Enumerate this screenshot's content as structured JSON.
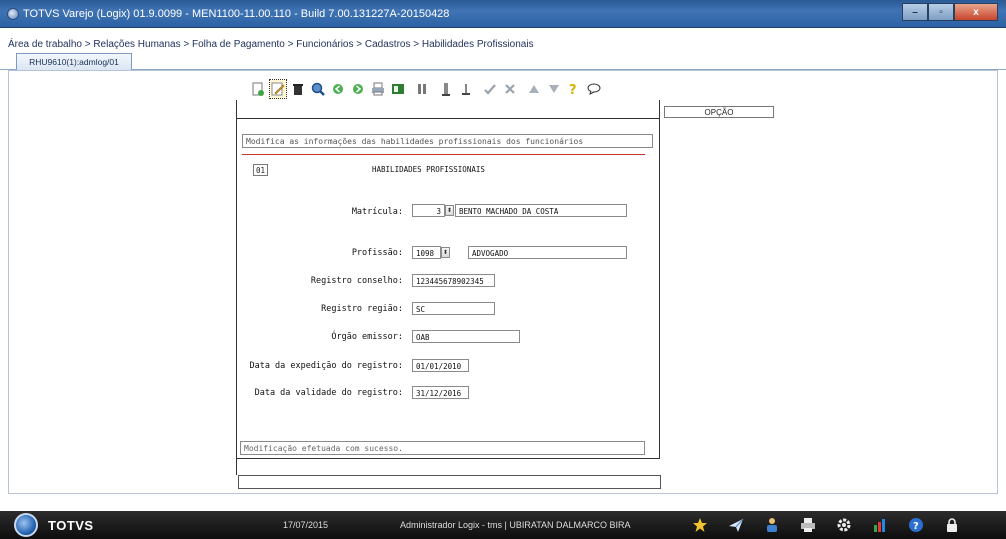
{
  "window": {
    "title": "TOTVS Varejo (Logix) 01.9.0099  -  MEN1100-11.00.110 - Build 7.00.131227A-20150428",
    "minimize_label": "–",
    "maximize_label": "▫",
    "close_label": "x"
  },
  "breadcrumb": "Área de trabalho > Relações Humanas > Folha de Pagamento > Funcionários > Cadastros > Habilidades Profissionais",
  "tabs": [
    {
      "label": "RHU9610(1):admlog/01"
    }
  ],
  "toolbar": {
    "icons": [
      "new-record-icon",
      "edit-icon",
      "delete-icon",
      "search-icon",
      "previous-icon",
      "next-icon",
      "print-icon",
      "export-icon",
      "first-icon",
      "last-icon",
      "field-down-icon",
      "confirm-icon",
      "cancel-icon",
      "move-up-icon",
      "move-down-icon",
      "help-icon",
      "comment-icon"
    ]
  },
  "option_panel": {
    "label": "OPÇÃO"
  },
  "form": {
    "description": "Modifica as informações das habilidades profissionais dos funcionários",
    "sequence": "01",
    "section_title": "HABILIDADES PROFISSIONAIS",
    "matricula": {
      "label": "Matrícula:",
      "code": "3",
      "name": "BENTO MACHADO DA COSTA"
    },
    "profissao": {
      "label": "Profissão:",
      "code": "1098",
      "name": "ADVOGADO"
    },
    "registro_conselho": {
      "label": "Registro conselho:",
      "value": "123445678902345"
    },
    "registro_regiao": {
      "label": "Registro região:",
      "value": "SC"
    },
    "orgao_emissor": {
      "label": "Órgão emissor:",
      "value": "OAB"
    },
    "data_expedicao": {
      "label": "Data da expedição do registro:",
      "value": "01/01/2010"
    },
    "data_validade": {
      "label": "Data da validade do registro:",
      "value": "31/12/2016"
    },
    "status_message": "Modificação efetuada com sucesso."
  },
  "taskbar": {
    "brand": "TOTVS",
    "date": "17/07/2015",
    "user": "Administrador Logix - tms | UBIRATAN DALMARCO BIRA",
    "tray": [
      "favorites-star-icon",
      "send-icon",
      "user-icon",
      "printer-icon",
      "settings-gear-icon",
      "chart-icon",
      "help-icon",
      "lock-icon"
    ]
  },
  "colors": {
    "title_bar": "#2c62a5",
    "separator_red": "#c8332d",
    "taskbar": "#111111"
  }
}
